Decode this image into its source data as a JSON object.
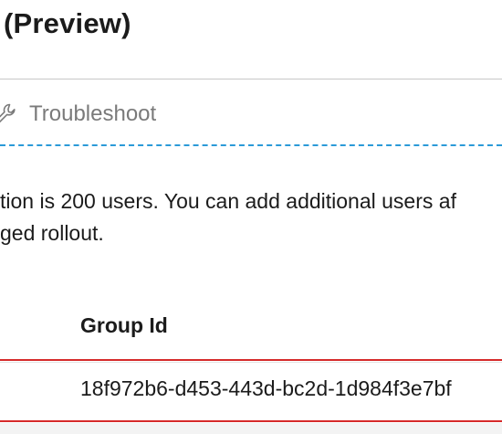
{
  "header": {
    "title": "(Preview)"
  },
  "toolbar": {
    "troubleshoot_label": "Troubleshoot",
    "icon": "wrench-icon"
  },
  "info": {
    "line1": "tion is 200 users. You can add additional users af",
    "line2": "ged rollout."
  },
  "table": {
    "columns": [
      "Group Id"
    ],
    "rows": [
      {
        "group_id": "18f972b6-d453-443d-bc2d-1d984f3e7bf"
      }
    ]
  },
  "colors": {
    "accent_dashed": "#2b9ad8",
    "highlight_red": "#d62a2a",
    "muted_text": "#7a7a7a",
    "text": "#1b1b1b"
  }
}
